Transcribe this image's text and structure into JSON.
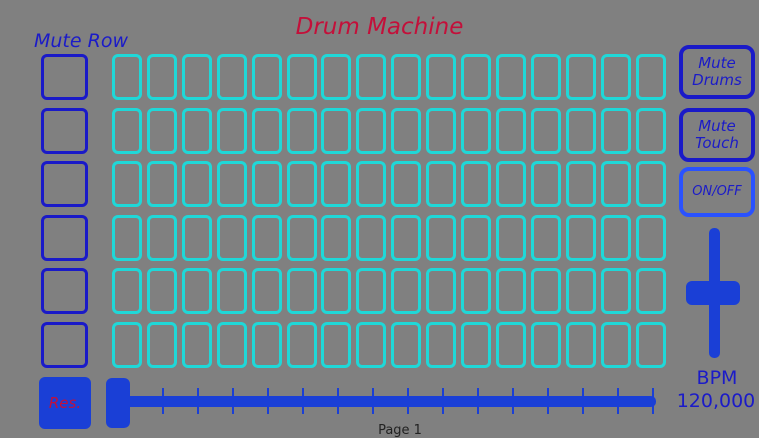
{
  "header": {
    "title": "Drum Machine",
    "mute_row_label": "Mute Row"
  },
  "grid": {
    "rows": 6,
    "columns": 16
  },
  "mute_buttons": [
    {
      "label": ""
    },
    {
      "label": ""
    },
    {
      "label": ""
    },
    {
      "label": ""
    },
    {
      "label": ""
    },
    {
      "label": ""
    }
  ],
  "side_buttons": {
    "mute_drums_label": "Mute\nDrums",
    "mute_touch_label": "Mute\nTouch",
    "on_off_label": "ON/OFF"
  },
  "reset_button_label": "Res.",
  "bpm": {
    "label": "BPM",
    "value": "120,000"
  },
  "page_label": "Page 1",
  "colors": {
    "background": "#808080",
    "title": "#c3103a",
    "blue": "#1a1ac8",
    "cyan": "#1fd8d8"
  }
}
